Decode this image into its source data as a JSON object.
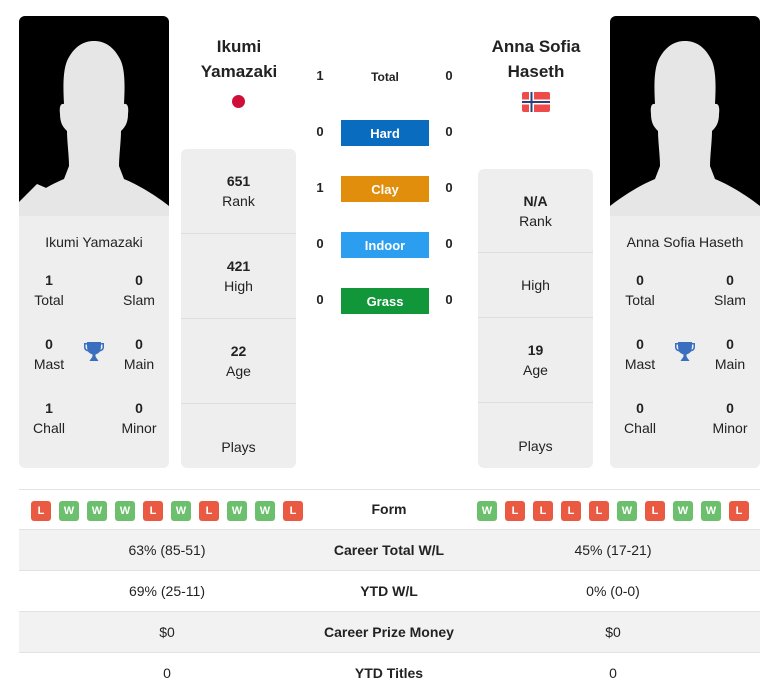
{
  "player1": {
    "name": "Ikumi Yamazaki",
    "name_line1": "Ikumi",
    "name_line2": "Yamazaki",
    "flag": "japan-flag",
    "titles": {
      "total": {
        "value": "1",
        "label": "Total"
      },
      "slam": {
        "value": "0",
        "label": "Slam"
      },
      "mast": {
        "value": "0",
        "label": "Mast"
      },
      "main": {
        "value": "0",
        "label": "Main"
      },
      "chall": {
        "value": "1",
        "label": "Chall"
      },
      "minor": {
        "value": "0",
        "label": "Minor"
      }
    },
    "stats": {
      "rank": {
        "value": "651",
        "label": "Rank"
      },
      "high": {
        "value": "421",
        "label": "High"
      },
      "age": {
        "value": "22",
        "label": "Age"
      },
      "plays": {
        "value": "",
        "label": "Plays"
      }
    },
    "form": [
      "L",
      "W",
      "W",
      "W",
      "L",
      "W",
      "L",
      "W",
      "W",
      "L"
    ]
  },
  "player2": {
    "name": "Anna Sofia Haseth",
    "name_line1": "Anna Sofia",
    "name_line2": "Haseth",
    "flag": "norway-flag",
    "titles": {
      "total": {
        "value": "0",
        "label": "Total"
      },
      "slam": {
        "value": "0",
        "label": "Slam"
      },
      "mast": {
        "value": "0",
        "label": "Mast"
      },
      "main": {
        "value": "0",
        "label": "Main"
      },
      "chall": {
        "value": "0",
        "label": "Chall"
      },
      "minor": {
        "value": "0",
        "label": "Minor"
      }
    },
    "stats": {
      "rank": {
        "value": "N/A",
        "label": "Rank"
      },
      "high": {
        "value": "",
        "label": "High"
      },
      "age": {
        "value": "19",
        "label": "Age"
      },
      "plays": {
        "value": "",
        "label": "Plays"
      }
    },
    "form": [
      "W",
      "L",
      "L",
      "L",
      "L",
      "W",
      "L",
      "W",
      "W",
      "L"
    ]
  },
  "h2h": [
    {
      "surface": "Total",
      "p1": "1",
      "p2": "0",
      "color": ""
    },
    {
      "surface": "Hard",
      "p1": "0",
      "p2": "0",
      "color": "#0a6cbf"
    },
    {
      "surface": "Clay",
      "p1": "1",
      "p2": "0",
      "color": "#e08e0b"
    },
    {
      "surface": "Indoor",
      "p1": "0",
      "p2": "0",
      "color": "#2c9ef0"
    },
    {
      "surface": "Grass",
      "p1": "0",
      "p2": "0",
      "color": "#11963a"
    }
  ],
  "form_label": "Form",
  "comparison": [
    {
      "label": "Career Total W/L",
      "p1": "63% (85-51)",
      "p2": "45% (17-21)"
    },
    {
      "label": "YTD W/L",
      "p1": "69% (25-11)",
      "p2": "0% (0-0)"
    },
    {
      "label": "Career Prize Money",
      "p1": "$0",
      "p2": "$0"
    },
    {
      "label": "YTD Titles",
      "p1": "0",
      "p2": "0"
    }
  ],
  "colors": {
    "win": "#6cbf6c",
    "loss": "#ea5a43",
    "trophy": "#3a6fbf"
  }
}
